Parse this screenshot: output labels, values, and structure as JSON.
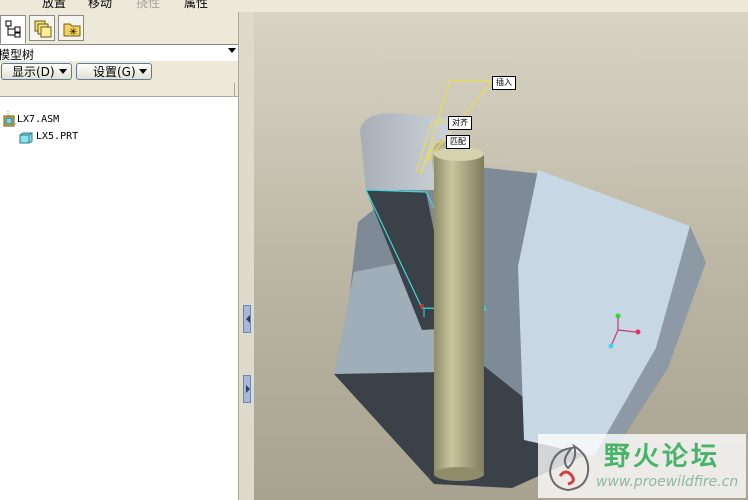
{
  "menu": {
    "items": [
      {
        "label": "放置",
        "dim": false
      },
      {
        "label": "移动",
        "dim": false
      },
      {
        "label": "挠性",
        "dim": true
      },
      {
        "label": "属性",
        "dim": false
      }
    ]
  },
  "panel": {
    "tabs": [
      {
        "name": "model-tree-tab-icon"
      },
      {
        "name": "layers-tab-icon"
      },
      {
        "name": "favorites-tab-icon"
      }
    ],
    "tree_title": "模型树",
    "show_button": "显示(D)",
    "settings_button": "设置(G)"
  },
  "tree": {
    "root": {
      "label": "LX7.ASM",
      "icon": "assembly-icon"
    },
    "children": [
      {
        "label": "LX5.PRT",
        "icon": "part-icon"
      }
    ]
  },
  "annotations": {
    "insert": "插入",
    "align": "对齐",
    "mate": "匹配"
  },
  "watermark": {
    "title": "野火论坛",
    "url": "www.proewildfire.cn"
  },
  "colors": {
    "part_block": "#c9d9e6",
    "part_block_dark": "#3a4048",
    "shaft": "#bcb990",
    "plane_outline": "#3fd8d8",
    "leader": "#f0e040"
  }
}
